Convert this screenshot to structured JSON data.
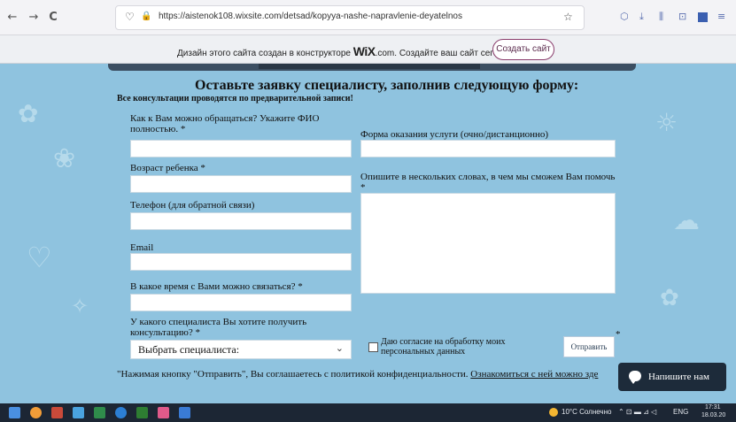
{
  "browser": {
    "url": "https://aistenok108.wixsite.com/detsad/kopyya-nashe-napravlenie-deyatelnos"
  },
  "wix_banner": {
    "text_before": "Дизайн этого сайта создан в конструкторе",
    "logo": "WiX",
    "text_after": ".com. Создайте ваш сайт сегодня.",
    "button": "Создать сайт"
  },
  "form": {
    "title": "Оставьте заявку специалисту, заполнив следующую форму:",
    "subtitle": "Все консультации проводятся по предварительной записи!",
    "fio_label": "Как к Вам можно обращаться? Укажите ФИО полностью. *",
    "format_label": "Форма оказания услуги (очно/дистанционно)",
    "age_label": "Возраст ребенка *",
    "describe_label": "Опишите в нескольких словах, в чем мы сможем Вам помочь *",
    "phone_label": "Телефон (для обратной связи)",
    "email_label": "Email",
    "time_label": "В какое время с Вами можно связаться? *",
    "specialist_label": "У какого специалиста Вы хотите получить консультацию? *",
    "specialist_selected": "Выбрать специалиста:",
    "consent_label": "Даю согласие на обработку моих персональных данных",
    "send_button": "Отправить",
    "asterisk": "*",
    "footnote_text": "\"Нажимая кнопку \"Отправить\", Вы соглашаетесь с политикой конфиденциальности.",
    "footnote_link": "Ознакомиться с ней можно зде"
  },
  "chat": {
    "label": "Напишите нам"
  },
  "taskbar": {
    "weather": "10°C Солнечно",
    "lang": "ENG",
    "time": "17:31",
    "date": "18.03.20"
  },
  "icons": {
    "back": "←",
    "forward": "→",
    "reload": "C",
    "shield": "♡",
    "lock": "🔒",
    "star": "☆",
    "pocket": "⬡",
    "download": "⤓",
    "library": "⫼",
    "reader": "⊡",
    "menu": "≡",
    "chevron": "⌄"
  },
  "colors": {
    "site_bg": "#8fc3df",
    "chat_bg": "#1d2b3a",
    "wix_btn_border": "#8a3c6c"
  }
}
